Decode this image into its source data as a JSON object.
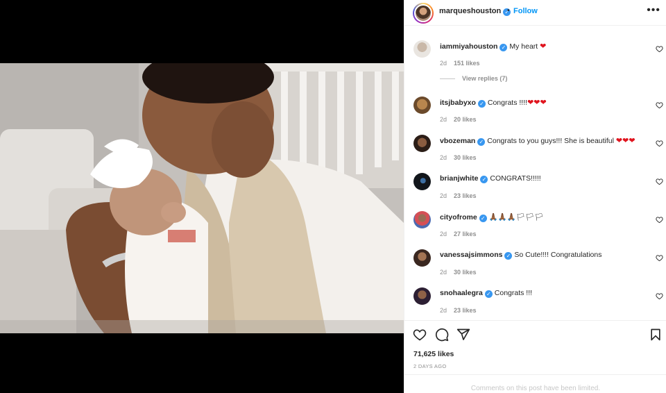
{
  "header": {
    "username": "marqueshouston",
    "dot": "•",
    "follow_label": "Follow",
    "more_label": "•••"
  },
  "verified_glyph": "✓",
  "comments": [
    {
      "username": "iammiyahouston",
      "text": "My heart",
      "emoji": "❤",
      "age": "2d",
      "likes": "151 likes",
      "avatar_color": "#e6e1dc"
    },
    {
      "username": "itsjbabyxo",
      "text": "Congrats !!!!",
      "emoji": "❤❤❤",
      "age": "2d",
      "likes": "20 likes",
      "avatar_color": "#b8864e"
    },
    {
      "username": "vbozeman",
      "text": "Congrats to you guys!!! She is beautiful",
      "emoji": "❤❤❤",
      "age": "2d",
      "likes": "30 likes",
      "avatar_color": "#3a2820"
    },
    {
      "username": "brianjwhite",
      "text": "CONGRATS!!!!!",
      "emoji": "",
      "age": "2d",
      "likes": "23 likes",
      "avatar_color": "#1d2126"
    },
    {
      "username": "cityofrome",
      "text": "🙏🏾🙏🏾🙏🏾🏳🏳🏳",
      "emoji": "",
      "age": "2d",
      "likes": "27 likes",
      "avatar_color": "#c0474d"
    },
    {
      "username": "vanessajsimmons",
      "text": "So Cute!!!! Congratulations",
      "emoji": "",
      "age": "2d",
      "likes": "30 likes",
      "avatar_color": "#5a3d2e"
    },
    {
      "username": "snohaalegra",
      "text": "Congrats !!!",
      "emoji": "",
      "age": "2d",
      "likes": "23 likes",
      "avatar_color": "#3b2a4a"
    }
  ],
  "view_replies": "View replies (7)",
  "actions": {
    "like_icon": "heart-outline-icon",
    "comment_icon": "comment-bubble-icon",
    "share_icon": "paper-plane-icon",
    "save_icon": "bookmark-icon"
  },
  "likes_total": "71,625 likes",
  "posted_ago": "2 DAYS AGO",
  "comments_limited": "Comments on this post have been limited."
}
